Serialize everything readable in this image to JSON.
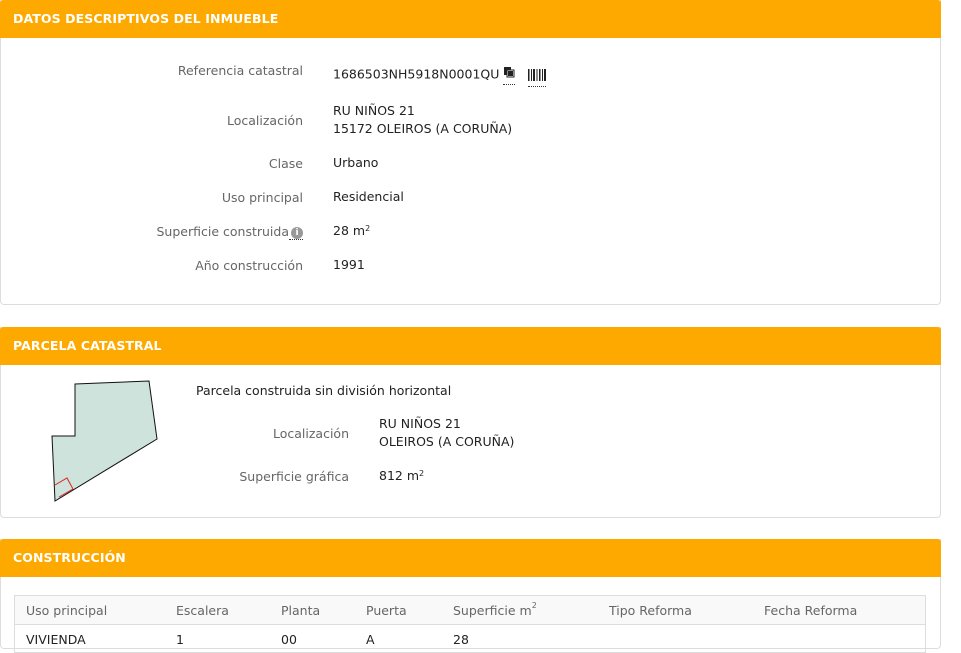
{
  "descriptivos": {
    "title": "DATOS DESCRIPTIVOS DEL INMUEBLE",
    "referencia_label": "Referencia catastral",
    "referencia_value": "1686503NH5918N0001QU",
    "localizacion_label": "Localización",
    "localizacion_line1": "RU NIÑOS 21",
    "localizacion_line2": "15172 OLEIROS (A CORUÑA)",
    "clase_label": "Clase",
    "clase_value": "Urbano",
    "uso_label": "Uso principal",
    "uso_value": "Residencial",
    "superficie_label": "Superficie construida",
    "superficie_value": "28 m",
    "superficie_unit_sup": "2",
    "anio_label": "Año construcción",
    "anio_value": "1991"
  },
  "parcela": {
    "title": "PARCELA CATASTRAL",
    "description": "Parcela construida sin división horizontal",
    "localizacion_label": "Localización",
    "localizacion_line1": "RU NIÑOS 21",
    "localizacion_line2": "OLEIROS (A CORUÑA)",
    "superficie_label": "Superficie gráfica",
    "superficie_value": "812 m",
    "superficie_unit_sup": "2",
    "plot_fill": "#cde3dc"
  },
  "construccion": {
    "title": "CONSTRUCCIÓN",
    "columns": [
      "Uso principal",
      "Escalera",
      "Planta",
      "Puerta",
      "Superficie m",
      "Tipo Reforma",
      "Fecha Reforma"
    ],
    "superficie_col_sup": "2",
    "rows": [
      [
        "VIVIENDA",
        "1",
        "00",
        "A",
        "28",
        "",
        ""
      ]
    ]
  },
  "colors": {
    "header": "#fda900",
    "label": "#666666"
  },
  "icons": {
    "copy": "copy-icon",
    "barcode": "barcode-icon",
    "info": "info-icon"
  }
}
